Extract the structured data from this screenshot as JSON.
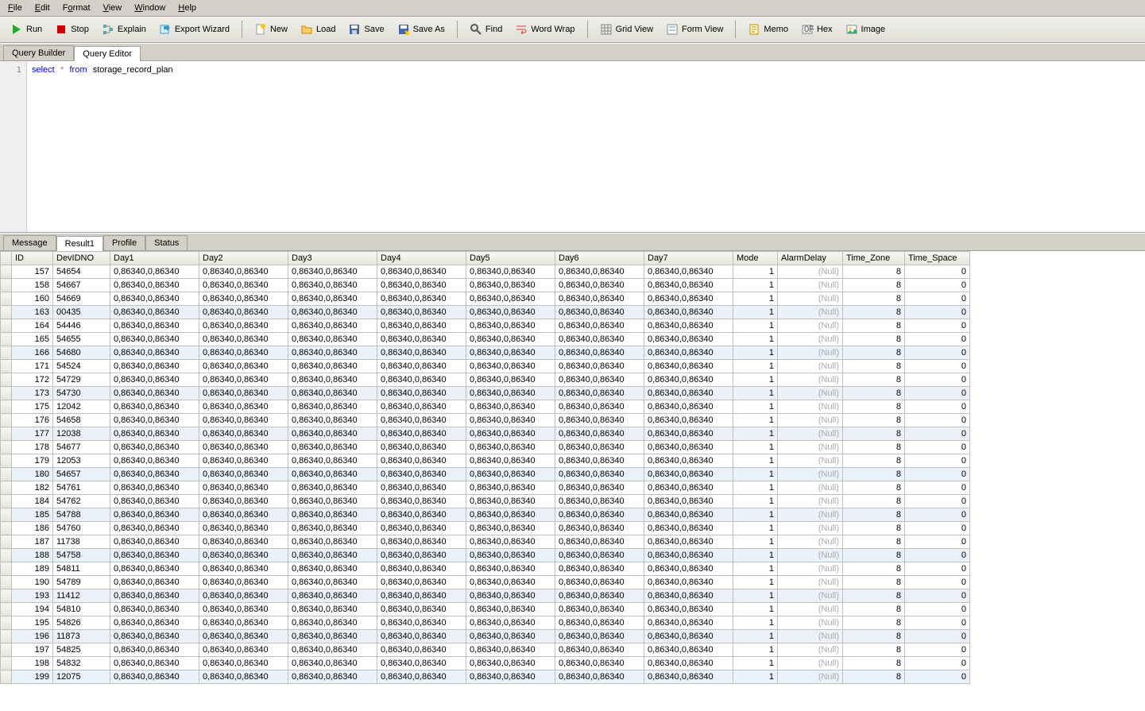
{
  "menu": {
    "items": [
      "File",
      "Edit",
      "Format",
      "View",
      "Window",
      "Help"
    ]
  },
  "toolbar": {
    "run": "Run",
    "stop": "Stop",
    "explain": "Explain",
    "export": "Export Wizard",
    "new": "New",
    "load": "Load",
    "save": "Save",
    "saveas": "Save As",
    "find": "Find",
    "wordwrap": "Word Wrap",
    "gridview": "Grid View",
    "formview": "Form View",
    "memo": "Memo",
    "hex": "Hex",
    "image": "Image"
  },
  "top_tabs": {
    "builder": "Query Builder",
    "editor": "Query Editor",
    "active": "editor"
  },
  "editor": {
    "line": "1",
    "sql_kw": "select",
    "sql_star": "*",
    "sql_from": "from",
    "sql_table": "storage_record_plan"
  },
  "btm_tabs": {
    "message": "Message",
    "result": "Result1",
    "profile": "Profile",
    "status": "Status",
    "active": "result"
  },
  "grid": {
    "columns": [
      "ID",
      "DevIDNO",
      "Day1",
      "Day2",
      "Day3",
      "Day4",
      "Day5",
      "Day6",
      "Day7",
      "Mode",
      "AlarmDelay",
      "Time_Zone",
      "Time_Space"
    ],
    "widths": [
      52,
      72,
      112,
      112,
      112,
      112,
      112,
      112,
      112,
      56,
      82,
      78,
      82
    ],
    "day_val": "0,86340,0,86340",
    "null": "(Null)",
    "rows": [
      {
        "id": 157,
        "dev": "54654",
        "mode": 1,
        "tz": 8,
        "ts": 0
      },
      {
        "id": 158,
        "dev": "54667",
        "mode": 1,
        "tz": 8,
        "ts": 0
      },
      {
        "id": 160,
        "dev": "54669",
        "mode": 1,
        "tz": 8,
        "ts": 0
      },
      {
        "id": 163,
        "dev": "00435",
        "mode": 1,
        "tz": 8,
        "ts": 0,
        "alt": true
      },
      {
        "id": 164,
        "dev": "54446",
        "mode": 1,
        "tz": 8,
        "ts": 0
      },
      {
        "id": 165,
        "dev": "54655",
        "mode": 1,
        "tz": 8,
        "ts": 0
      },
      {
        "id": 166,
        "dev": "54680",
        "mode": 1,
        "tz": 8,
        "ts": 0,
        "alt": true
      },
      {
        "id": 171,
        "dev": "54524",
        "mode": 1,
        "tz": 8,
        "ts": 0
      },
      {
        "id": 172,
        "dev": "54729",
        "mode": 1,
        "tz": 8,
        "ts": 0
      },
      {
        "id": 173,
        "dev": "54730",
        "mode": 1,
        "tz": 8,
        "ts": 0,
        "alt": true
      },
      {
        "id": 175,
        "dev": "12042",
        "mode": 1,
        "tz": 8,
        "ts": 0
      },
      {
        "id": 176,
        "dev": "54658",
        "mode": 1,
        "tz": 8,
        "ts": 0
      },
      {
        "id": 177,
        "dev": "12038",
        "mode": 1,
        "tz": 8,
        "ts": 0,
        "alt": true
      },
      {
        "id": 178,
        "dev": "54677",
        "mode": 1,
        "tz": 8,
        "ts": 0
      },
      {
        "id": 179,
        "dev": "12053",
        "mode": 1,
        "tz": 8,
        "ts": 0
      },
      {
        "id": 180,
        "dev": "54657",
        "mode": 1,
        "tz": 8,
        "ts": 0,
        "alt": true
      },
      {
        "id": 182,
        "dev": "54761",
        "mode": 1,
        "tz": 8,
        "ts": 0
      },
      {
        "id": 184,
        "dev": "54762",
        "mode": 1,
        "tz": 8,
        "ts": 0
      },
      {
        "id": 185,
        "dev": "54788",
        "mode": 1,
        "tz": 8,
        "ts": 0,
        "alt": true
      },
      {
        "id": 186,
        "dev": "54760",
        "mode": 1,
        "tz": 8,
        "ts": 0
      },
      {
        "id": 187,
        "dev": "11738",
        "mode": 1,
        "tz": 8,
        "ts": 0
      },
      {
        "id": 188,
        "dev": "54758",
        "mode": 1,
        "tz": 8,
        "ts": 0,
        "alt": true
      },
      {
        "id": 189,
        "dev": "54811",
        "mode": 1,
        "tz": 8,
        "ts": 0
      },
      {
        "id": 190,
        "dev": "54789",
        "mode": 1,
        "tz": 8,
        "ts": 0
      },
      {
        "id": 193,
        "dev": "11412",
        "mode": 1,
        "tz": 8,
        "ts": 0,
        "alt": true
      },
      {
        "id": 194,
        "dev": "54810",
        "mode": 1,
        "tz": 8,
        "ts": 0
      },
      {
        "id": 195,
        "dev": "54826",
        "mode": 1,
        "tz": 8,
        "ts": 0
      },
      {
        "id": 196,
        "dev": "11873",
        "mode": 1,
        "tz": 8,
        "ts": 0,
        "alt": true
      },
      {
        "id": 197,
        "dev": "54825",
        "mode": 1,
        "tz": 8,
        "ts": 0
      },
      {
        "id": 198,
        "dev": "54832",
        "mode": 1,
        "tz": 8,
        "ts": 0
      },
      {
        "id": 199,
        "dev": "12075",
        "mode": 1,
        "tz": 8,
        "ts": 0,
        "alt": true
      }
    ]
  }
}
